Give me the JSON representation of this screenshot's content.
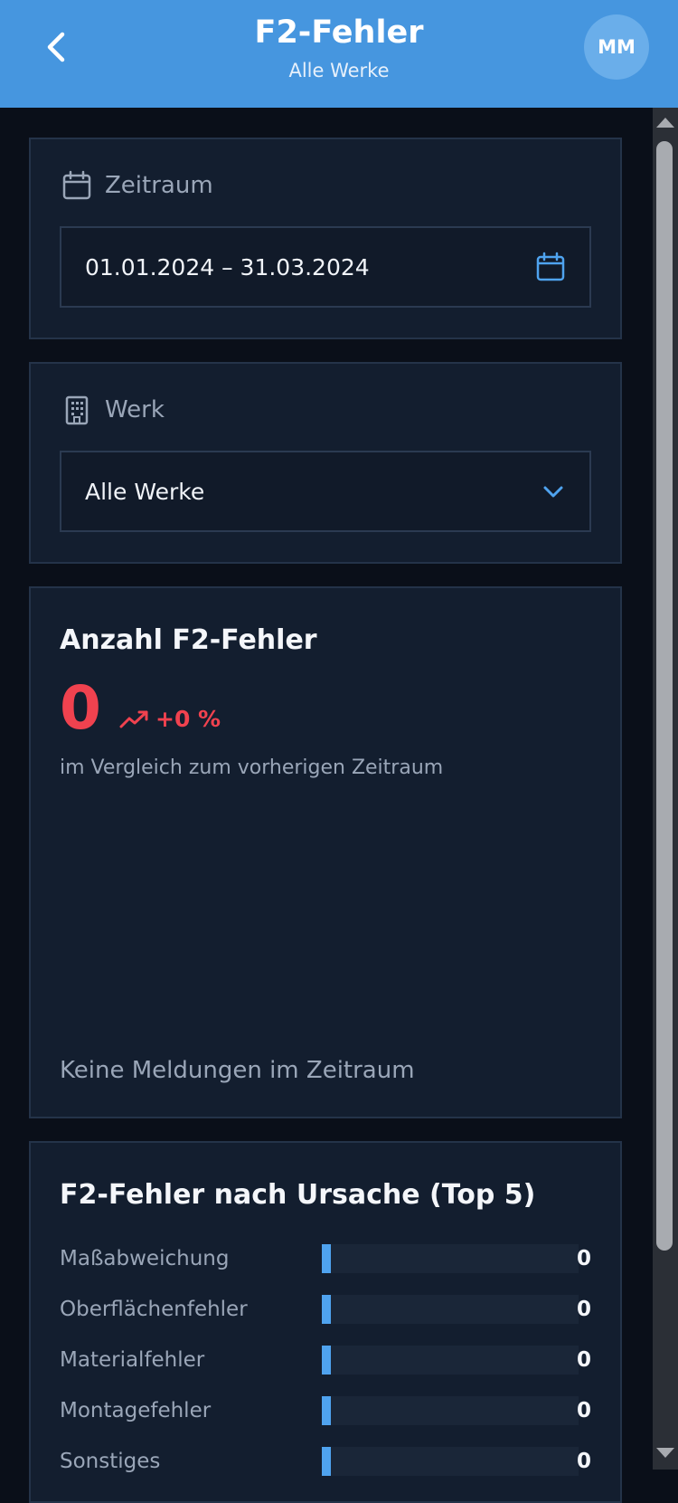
{
  "header": {
    "title": "F2-Fehler",
    "subtitle": "Alle Werke",
    "avatar_initials": "MM",
    "back_icon": "chevron-left-icon"
  },
  "filters": {
    "period": {
      "label": "Zeitraum",
      "value": "01.01.2024 – 31.03.2024",
      "label_icon": "calendar-icon",
      "action_icon": "calendar-icon"
    },
    "plant": {
      "label": "Werk",
      "value": "Alle Werke",
      "label_icon": "building-icon",
      "action_icon": "chevron-down-icon"
    }
  },
  "count_card": {
    "title": "Anzahl F2-Fehler",
    "value": "0",
    "trend": "+0 %",
    "trend_icon": "trending-up-icon",
    "comparison_text": "im Vergleich zum vorherigen Zeitraum",
    "empty_text": "Keine Meldungen im Zeitraum"
  },
  "causes_card": {
    "title": "F2-Fehler nach Ursache (Top 5)",
    "rows": [
      {
        "label": "Maßabweichung",
        "value": "0"
      },
      {
        "label": "Oberflächenfehler",
        "value": "0"
      },
      {
        "label": "Materialfehler",
        "value": "0"
      },
      {
        "label": "Montagefehler",
        "value": "0"
      },
      {
        "label": "Sonstiges",
        "value": "0"
      }
    ]
  },
  "colors": {
    "header": "#4696df",
    "accent": "#4fa3ef",
    "negative": "#f0424f",
    "card": "#131e2f",
    "background": "#0a0f19"
  }
}
